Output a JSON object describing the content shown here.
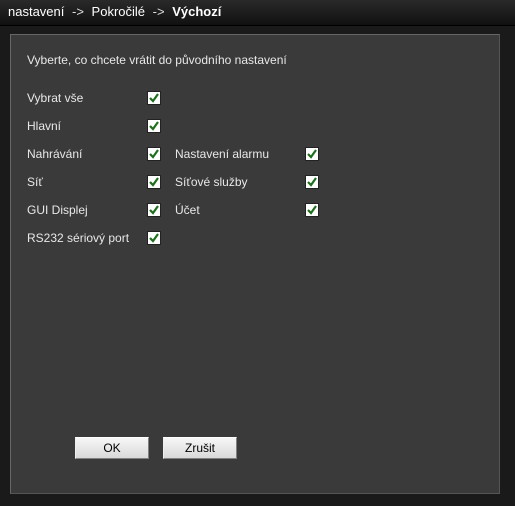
{
  "title": {
    "seg1": "nastavení",
    "sep": "->",
    "seg2": "Pokročilé",
    "seg3": "Výchozí"
  },
  "instruction": "Vyberte, co chcete vrátit do původního nastavení",
  "options": {
    "select_all": {
      "label": "Vybrat vše",
      "checked": true
    },
    "general": {
      "label": "Hlavní",
      "checked": true
    },
    "record": {
      "label": "Nahrávání",
      "checked": true
    },
    "alarm": {
      "label": "Nastavení alarmu",
      "checked": true
    },
    "network": {
      "label": "Síť",
      "checked": true
    },
    "netservice": {
      "label": "Síťové služby",
      "checked": true
    },
    "gui": {
      "label": "GUI Displej",
      "checked": true
    },
    "account": {
      "label": "Účet",
      "checked": true
    },
    "rs232": {
      "label": "RS232 sériový port",
      "checked": true
    }
  },
  "buttons": {
    "ok": "OK",
    "cancel": "Zrušit"
  }
}
